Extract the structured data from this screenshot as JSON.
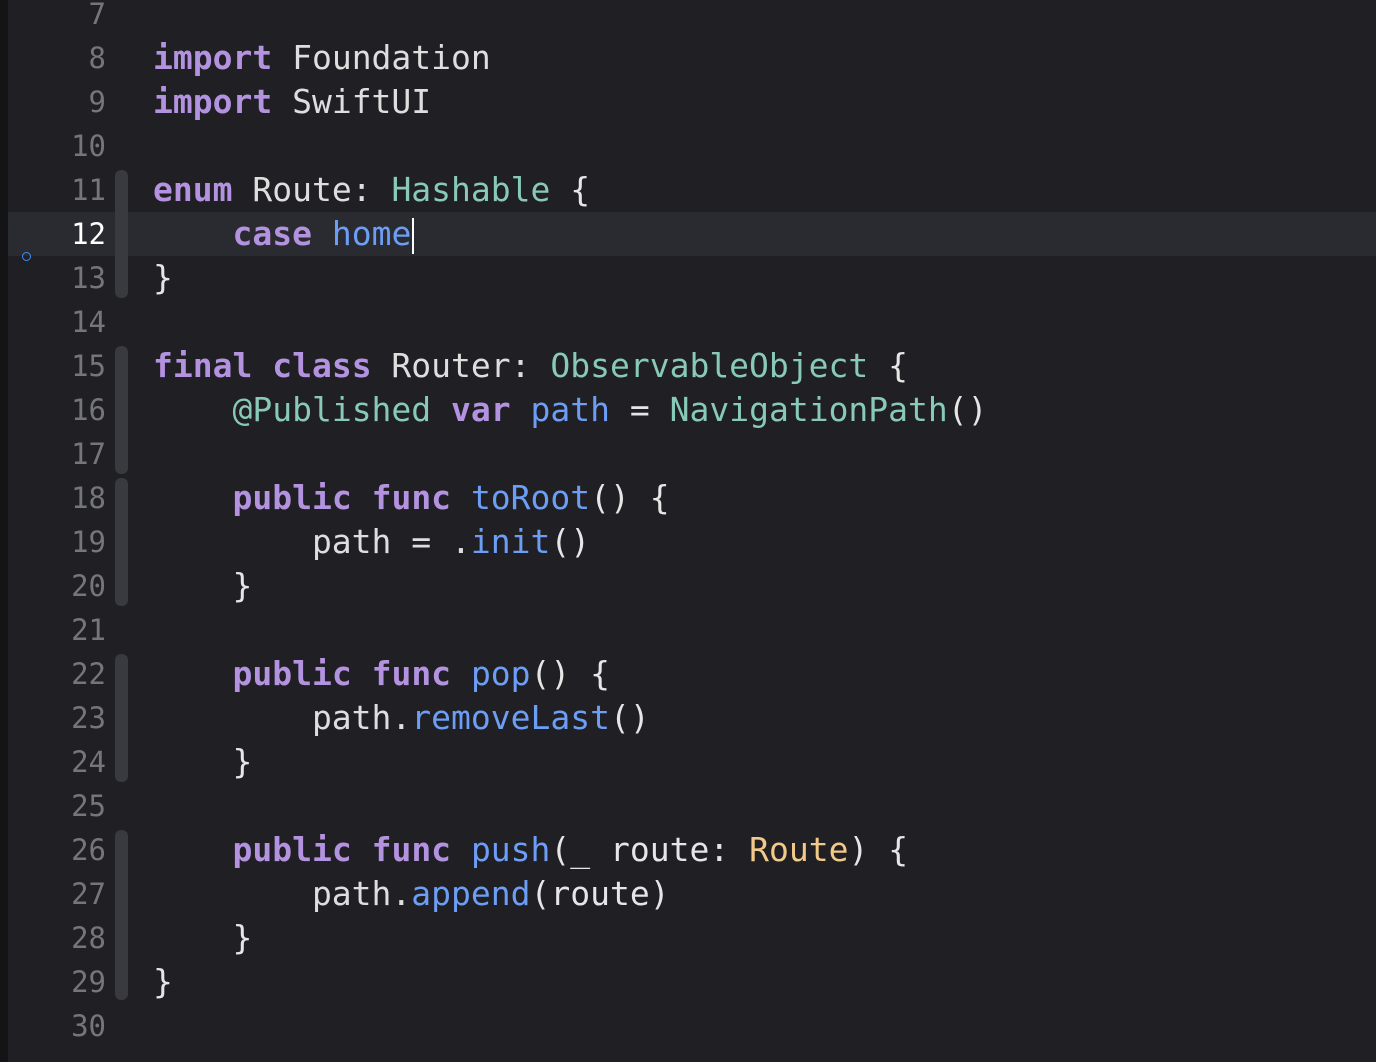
{
  "editor": {
    "language": "Swift",
    "active_line": "12",
    "colors": {
      "background": "#1f1f24",
      "keyword": "#b393e0",
      "system_type": "#88c9b8",
      "function": "#6d9ef5",
      "declared_type": "#f3c989",
      "line_number": "#75767c"
    },
    "lines": [
      {
        "n": "7",
        "code": []
      },
      {
        "n": "8",
        "code": [
          {
            "t": "import",
            "c": "kw"
          },
          {
            "t": " Foundation",
            "c": "prop"
          }
        ]
      },
      {
        "n": "9",
        "code": [
          {
            "t": "import",
            "c": "kw"
          },
          {
            "t": " SwiftUI",
            "c": "prop"
          }
        ]
      },
      {
        "n": "10",
        "code": []
      },
      {
        "n": "11",
        "code": [
          {
            "t": "enum",
            "c": "kw"
          },
          {
            "t": " Route: ",
            "c": "prop"
          },
          {
            "t": "Hashable",
            "c": "type-sys"
          },
          {
            "t": " {",
            "c": "punc"
          }
        ]
      },
      {
        "n": "12",
        "code": [
          {
            "t": "    ",
            "c": "punc"
          },
          {
            "t": "case",
            "c": "kw"
          },
          {
            "t": " ",
            "c": "punc"
          },
          {
            "t": "home",
            "c": "fn"
          }
        ]
      },
      {
        "n": "13",
        "code": [
          {
            "t": "}",
            "c": "punc"
          }
        ]
      },
      {
        "n": "14",
        "code": []
      },
      {
        "n": "15",
        "code": [
          {
            "t": "final",
            "c": "kw"
          },
          {
            "t": " ",
            "c": "punc"
          },
          {
            "t": "class",
            "c": "kw"
          },
          {
            "t": " Router: ",
            "c": "prop"
          },
          {
            "t": "ObservableObject",
            "c": "type-sys"
          },
          {
            "t": " {",
            "c": "punc"
          }
        ]
      },
      {
        "n": "16",
        "code": [
          {
            "t": "    ",
            "c": "punc"
          },
          {
            "t": "@Published",
            "c": "attr"
          },
          {
            "t": " ",
            "c": "punc"
          },
          {
            "t": "var",
            "c": "kw"
          },
          {
            "t": " ",
            "c": "punc"
          },
          {
            "t": "path",
            "c": "fn"
          },
          {
            "t": " = ",
            "c": "punc"
          },
          {
            "t": "NavigationPath",
            "c": "type-sys"
          },
          {
            "t": "()",
            "c": "punc"
          }
        ]
      },
      {
        "n": "17",
        "code": []
      },
      {
        "n": "18",
        "code": [
          {
            "t": "    ",
            "c": "punc"
          },
          {
            "t": "public",
            "c": "kw"
          },
          {
            "t": " ",
            "c": "punc"
          },
          {
            "t": "func",
            "c": "kw"
          },
          {
            "t": " ",
            "c": "punc"
          },
          {
            "t": "toRoot",
            "c": "fn"
          },
          {
            "t": "() {",
            "c": "punc"
          }
        ]
      },
      {
        "n": "19",
        "code": [
          {
            "t": "        path = .",
            "c": "prop"
          },
          {
            "t": "init",
            "c": "fn"
          },
          {
            "t": "()",
            "c": "punc"
          }
        ]
      },
      {
        "n": "20",
        "code": [
          {
            "t": "    }",
            "c": "punc"
          }
        ]
      },
      {
        "n": "21",
        "code": []
      },
      {
        "n": "22",
        "code": [
          {
            "t": "    ",
            "c": "punc"
          },
          {
            "t": "public",
            "c": "kw"
          },
          {
            "t": " ",
            "c": "punc"
          },
          {
            "t": "func",
            "c": "kw"
          },
          {
            "t": " ",
            "c": "punc"
          },
          {
            "t": "pop",
            "c": "fn"
          },
          {
            "t": "() {",
            "c": "punc"
          }
        ]
      },
      {
        "n": "23",
        "code": [
          {
            "t": "        path.",
            "c": "prop"
          },
          {
            "t": "removeLast",
            "c": "fn"
          },
          {
            "t": "()",
            "c": "punc"
          }
        ]
      },
      {
        "n": "24",
        "code": [
          {
            "t": "    }",
            "c": "punc"
          }
        ]
      },
      {
        "n": "25",
        "code": []
      },
      {
        "n": "26",
        "code": [
          {
            "t": "    ",
            "c": "punc"
          },
          {
            "t": "public",
            "c": "kw"
          },
          {
            "t": " ",
            "c": "punc"
          },
          {
            "t": "func",
            "c": "kw"
          },
          {
            "t": " ",
            "c": "punc"
          },
          {
            "t": "push",
            "c": "fn"
          },
          {
            "t": "(_ route: ",
            "c": "punc"
          },
          {
            "t": "Route",
            "c": "type-decl"
          },
          {
            "t": ") {",
            "c": "punc"
          }
        ]
      },
      {
        "n": "27",
        "code": [
          {
            "t": "        path.",
            "c": "prop"
          },
          {
            "t": "append",
            "c": "fn"
          },
          {
            "t": "(route)",
            "c": "punc"
          }
        ]
      },
      {
        "n": "28",
        "code": [
          {
            "t": "    }",
            "c": "punc"
          }
        ]
      },
      {
        "n": "29",
        "code": [
          {
            "t": "}",
            "c": "punc"
          }
        ]
      },
      {
        "n": "30",
        "code": []
      }
    ]
  }
}
